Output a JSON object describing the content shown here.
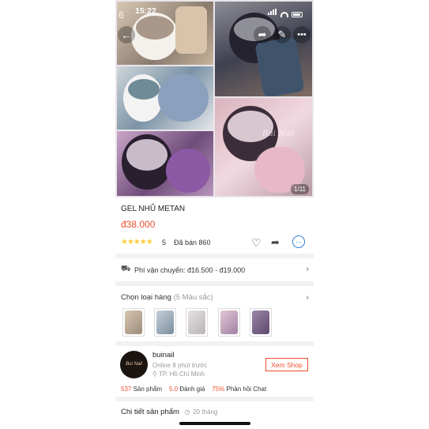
{
  "status_bar": {
    "time": "15:22"
  },
  "gallery": {
    "counter": "1/11",
    "tile_number": "6",
    "watermark": "Bui Nail"
  },
  "product": {
    "name": "GEL NHŨ METAN",
    "price": "đ38.000",
    "rating": "5",
    "sold": "Đã bán 860"
  },
  "shipping": {
    "label": "Phí vận chuyển: đ16.500 - đ19.000"
  },
  "variants": {
    "title": "Chọn loại hàng",
    "count": "(5 Màu sắc)",
    "colors": [
      "#9d8c7c",
      "#7b8ea0",
      "#b9b4b6",
      "#a080a6",
      "#5d4a6b"
    ]
  },
  "shop": {
    "logo": "Bui Nail",
    "name": "buinail",
    "online": "Online 8 phút trước",
    "location": "TP. Hồ Chí Minh",
    "view_button": "Xem Shop",
    "products_count": "537",
    "products_label": "Sản phẩm",
    "rating_value": "5.0",
    "rating_label": "Đánh giá",
    "chat_value": "75%",
    "chat_label": "Phản hồi Chat"
  },
  "details": {
    "title": "Chi tiết sản phẩm",
    "sub": "20 tháng"
  },
  "colors": {
    "accent": "#ee4d2d",
    "star": "#ffce3d",
    "chat_icon": "#2f7bd9"
  }
}
